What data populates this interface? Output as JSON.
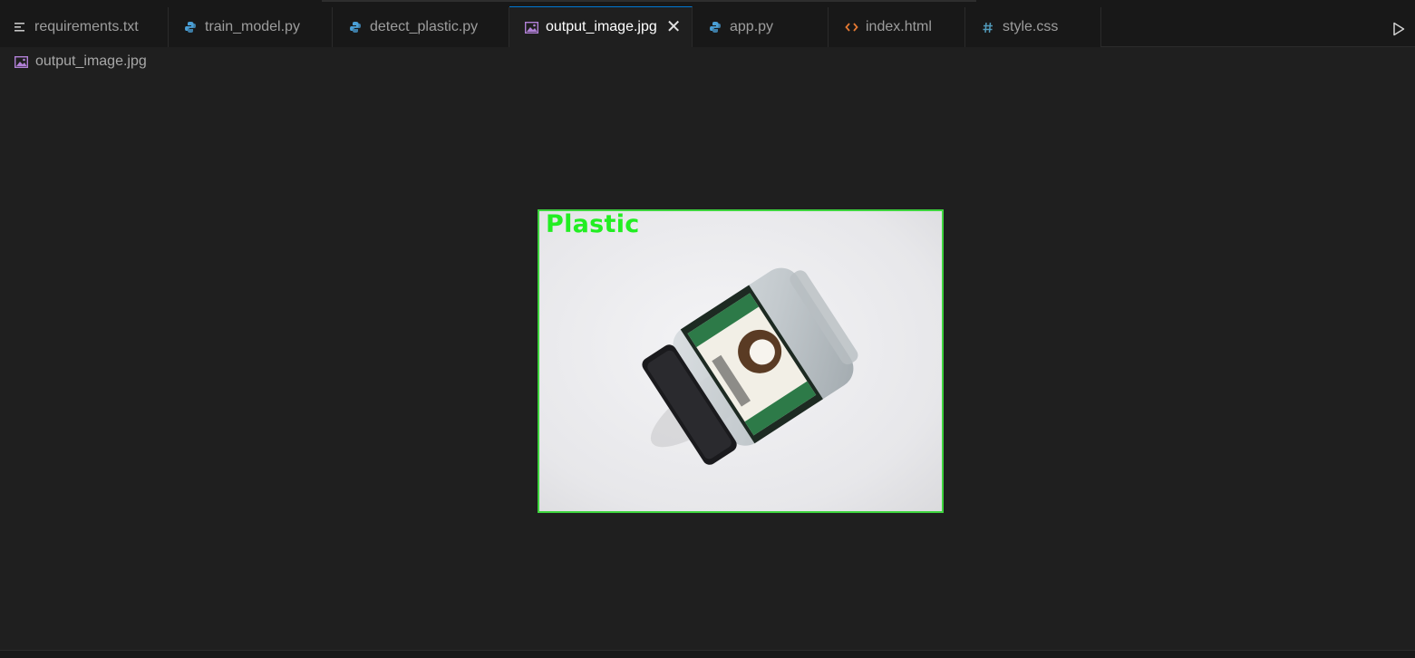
{
  "editor": {
    "tabs": [
      {
        "label": "requirements.txt",
        "icon": "text-file-icon",
        "active": false
      },
      {
        "label": "train_model.py",
        "icon": "python-icon",
        "active": false
      },
      {
        "label": "detect_plastic.py",
        "icon": "python-icon",
        "active": false
      },
      {
        "label": "output_image.jpg",
        "icon": "image-file-icon",
        "active": true
      },
      {
        "label": "app.py",
        "icon": "python-icon",
        "active": false
      },
      {
        "label": "index.html",
        "icon": "html-code-icon",
        "active": false
      },
      {
        "label": "style.css",
        "icon": "css-hash-icon",
        "active": false
      }
    ],
    "close_glyph": "✕",
    "run_icon": "play-icon"
  },
  "breadcrumb": {
    "file": "output_image.jpg",
    "icon": "image-file-icon"
  },
  "image_preview": {
    "label": "Plastic",
    "label_color": "#22ee22",
    "box_color": "#3ed43e"
  },
  "colors": {
    "background": "#1f1f1f",
    "tabbar": "#181818",
    "accent": "#0078d4",
    "python_icon": "#4a9fd6",
    "image_icon": "#b180d7",
    "html_icon": "#e37933",
    "css_icon": "#519aba"
  }
}
